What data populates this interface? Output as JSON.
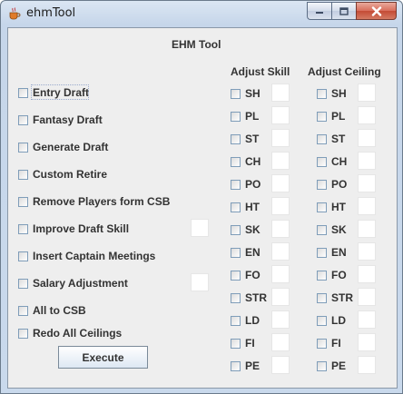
{
  "window": {
    "title": "ehmTool",
    "icon": "java-cup-icon",
    "controls": [
      "minimize-icon",
      "maximize-icon",
      "close-icon"
    ]
  },
  "panel": {
    "heading": "EHM Tool",
    "options": [
      {
        "label": "Entry Draft",
        "checked": false,
        "has_field": false,
        "field_value": ""
      },
      {
        "label": "Fantasy Draft",
        "checked": false,
        "has_field": false,
        "field_value": ""
      },
      {
        "label": "Generate Draft",
        "checked": false,
        "has_field": false,
        "field_value": ""
      },
      {
        "label": "Custom Retire",
        "checked": false,
        "has_field": false,
        "field_value": ""
      },
      {
        "label": "Remove Players form CSB",
        "checked": false,
        "has_field": false,
        "field_value": ""
      },
      {
        "label": "Improve Draft Skill",
        "checked": false,
        "has_field": true,
        "field_value": ""
      },
      {
        "label": "Insert Captain Meetings",
        "checked": false,
        "has_field": false,
        "field_value": ""
      },
      {
        "label": "Salary Adjustment",
        "checked": false,
        "has_field": true,
        "field_value": ""
      },
      {
        "label": "All to CSB",
        "checked": false,
        "has_field": false,
        "field_value": ""
      },
      {
        "label": "Redo  All Ceilings",
        "checked": false,
        "has_field": false,
        "field_value": ""
      }
    ],
    "execute_label": "Execute",
    "adjust_skill": {
      "heading": "Adjust Skill",
      "items": [
        {
          "label": "SH",
          "checked": false,
          "value": ""
        },
        {
          "label": "PL",
          "checked": false,
          "value": ""
        },
        {
          "label": "ST",
          "checked": false,
          "value": ""
        },
        {
          "label": "CH",
          "checked": false,
          "value": ""
        },
        {
          "label": "PO",
          "checked": false,
          "value": ""
        },
        {
          "label": "HT",
          "checked": false,
          "value": ""
        },
        {
          "label": "SK",
          "checked": false,
          "value": ""
        },
        {
          "label": "EN",
          "checked": false,
          "value": ""
        },
        {
          "label": "FO",
          "checked": false,
          "value": ""
        },
        {
          "label": "STR",
          "checked": false,
          "value": ""
        },
        {
          "label": "LD",
          "checked": false,
          "value": ""
        },
        {
          "label": "FI",
          "checked": false,
          "value": ""
        },
        {
          "label": "PE",
          "checked": false,
          "value": ""
        }
      ]
    },
    "adjust_ceiling": {
      "heading": "Adjust Ceiling",
      "items": [
        {
          "label": "SH",
          "checked": false,
          "value": ""
        },
        {
          "label": "PL",
          "checked": false,
          "value": ""
        },
        {
          "label": "ST",
          "checked": false,
          "value": ""
        },
        {
          "label": "CH",
          "checked": false,
          "value": ""
        },
        {
          "label": "PO",
          "checked": false,
          "value": ""
        },
        {
          "label": "HT",
          "checked": false,
          "value": ""
        },
        {
          "label": "SK",
          "checked": false,
          "value": ""
        },
        {
          "label": "EN",
          "checked": false,
          "value": ""
        },
        {
          "label": "FO",
          "checked": false,
          "value": ""
        },
        {
          "label": "STR",
          "checked": false,
          "value": ""
        },
        {
          "label": "LD",
          "checked": false,
          "value": ""
        },
        {
          "label": "FI",
          "checked": false,
          "value": ""
        },
        {
          "label": "PE",
          "checked": false,
          "value": ""
        }
      ]
    }
  }
}
